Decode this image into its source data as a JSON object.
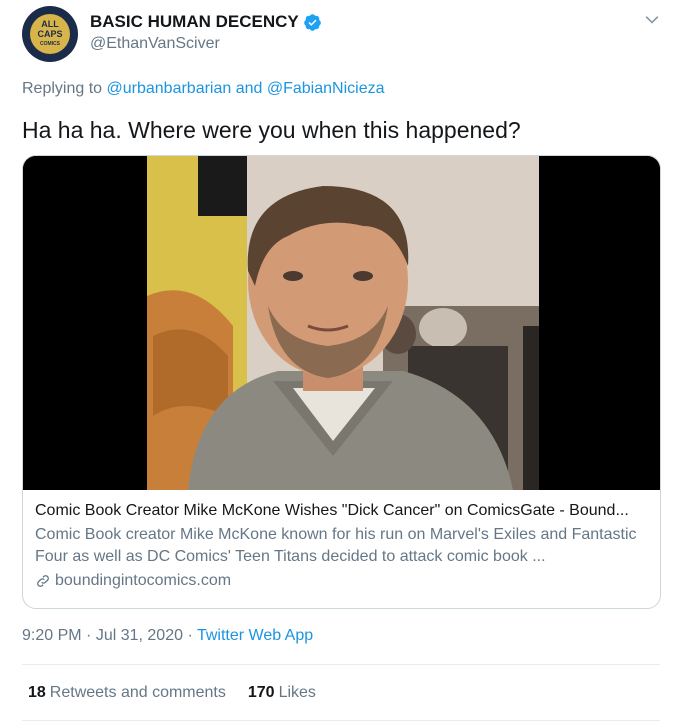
{
  "author": {
    "display_name": "BASIC HUMAN DECENCY",
    "handle": "@EthanVanSciver",
    "avatar_text": [
      "ALL",
      "CAPS",
      "COMICS"
    ],
    "verified": true
  },
  "reply": {
    "prefix": "Replying to ",
    "user1": "@urbanbarbarian",
    "and": " and ",
    "user2": "@FabianNicieza"
  },
  "tweet": {
    "text": "Ha ha ha.  Where were you when this happened?"
  },
  "card": {
    "title": "Comic Book Creator Mike McKone Wishes \"Dick Cancer\" on ComicsGate - Bound...",
    "description": "Comic Book creator Mike McKone known for his run on Marvel's Exiles and Fantastic Four as well as DC Comics' Teen Titans decided to attack comic book ...",
    "domain": "boundingintocomics.com",
    "image_alt": "photo"
  },
  "meta": {
    "time": "9:20 PM",
    "separator": " · ",
    "date": "Jul 31, 2020",
    "separator2": " · ",
    "app": "Twitter Web App"
  },
  "stats": {
    "retweets_count": "18",
    "retweets_label": "Retweets and comments",
    "likes_count": "170",
    "likes_label": "Likes"
  },
  "colors": {
    "link": "#1b95e0",
    "secondary": "#657786",
    "verified": "#1da1f2"
  }
}
